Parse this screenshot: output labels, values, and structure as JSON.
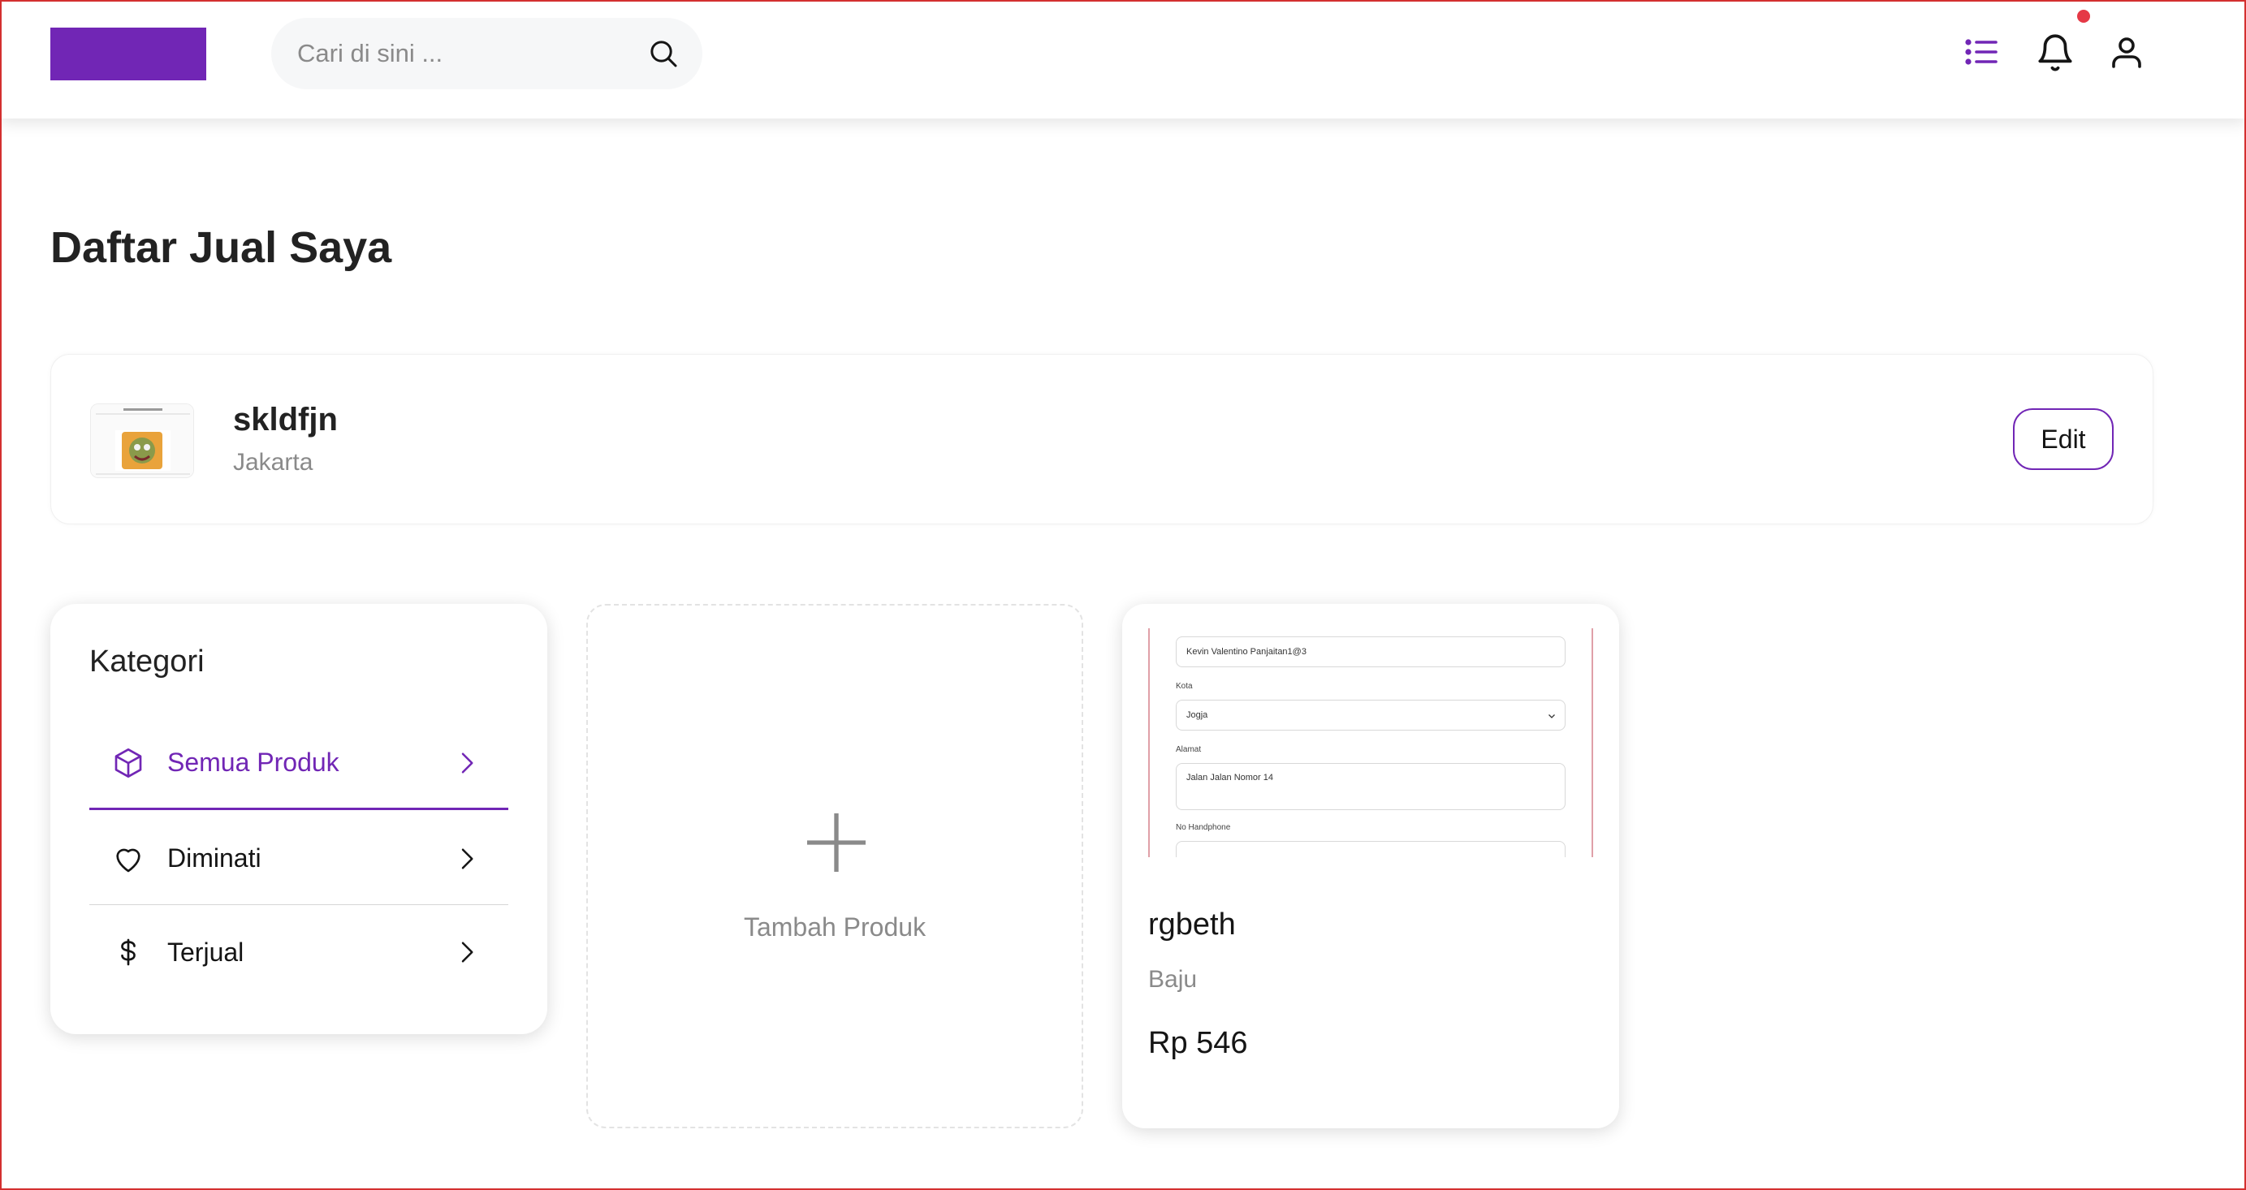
{
  "header": {
    "logo": "brand-logo",
    "search_placeholder": "Cari di sini ...",
    "icons": [
      "list-icon",
      "bell-icon",
      "user-icon"
    ],
    "has_notification": true
  },
  "page": {
    "title": "Daftar Jual Saya"
  },
  "seller": {
    "name": "skldfjn",
    "city": "Jakarta",
    "edit_label": "Edit"
  },
  "categories": {
    "title": "Kategori",
    "items": [
      {
        "label": "Semua Produk",
        "icon": "box-icon",
        "active": true
      },
      {
        "label": "Diminati",
        "icon": "heart-icon",
        "active": false
      },
      {
        "label": "Terjual",
        "icon": "dollar-icon",
        "active": false
      }
    ]
  },
  "add_product": {
    "label": "Tambah Produk"
  },
  "products": [
    {
      "name": "rgbeth",
      "category": "Baju",
      "price": "Rp 546",
      "thumbnail": {
        "field_name": "Kevin Valentino Panjaitan1@3",
        "label_city": "Kota",
        "field_city": "Jogja",
        "label_address": "Alamat",
        "field_address": "Jalan Jalan Nomor 14",
        "label_phone": "No Handphone"
      }
    }
  ],
  "colors": {
    "accent": "#7126b5",
    "notification": "#e53946",
    "annotation": "#d32f2f"
  }
}
